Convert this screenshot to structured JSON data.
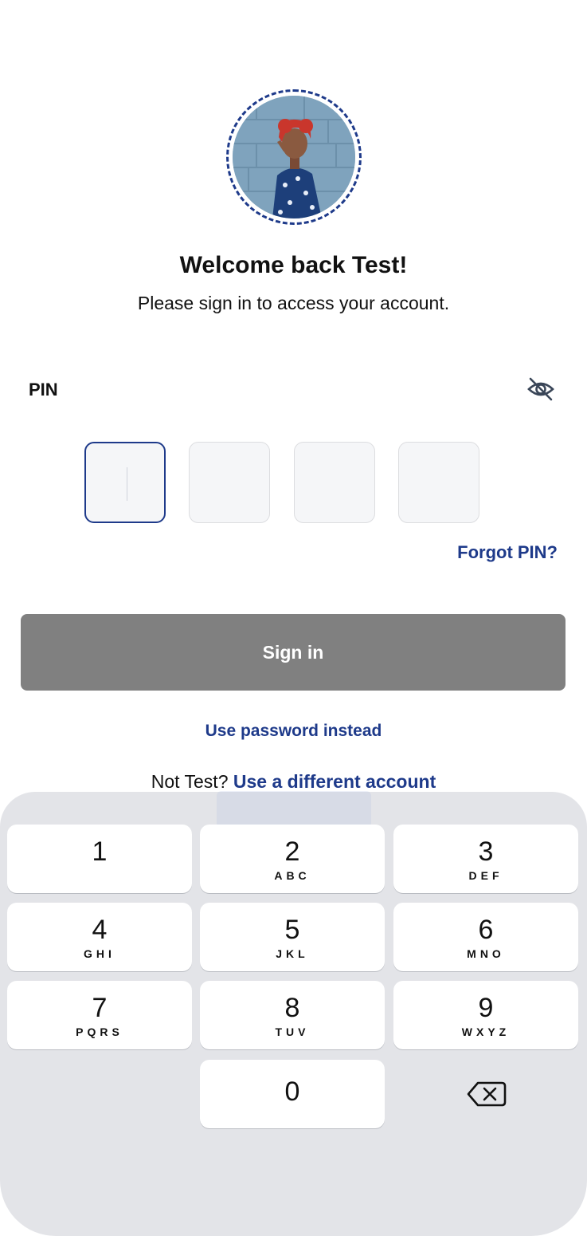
{
  "header": {
    "title": "Welcome back Test!",
    "subtitle": "Please sign in to access your account."
  },
  "pin": {
    "label": "PIN",
    "toggle_icon": "eye-off-icon",
    "boxes": [
      "",
      "",
      "",
      ""
    ],
    "forgot_label": "Forgot PIN?"
  },
  "actions": {
    "signin_label": "Sign in",
    "use_password_label": "Use password instead",
    "not_user_prefix": "Not Test?",
    "different_account_label": "Use a different account"
  },
  "keypad": {
    "keys": [
      {
        "digit": "1",
        "letters": ""
      },
      {
        "digit": "2",
        "letters": "ABC"
      },
      {
        "digit": "3",
        "letters": "DEF"
      },
      {
        "digit": "4",
        "letters": "GHI"
      },
      {
        "digit": "5",
        "letters": "JKL"
      },
      {
        "digit": "6",
        "letters": "MNO"
      },
      {
        "digit": "7",
        "letters": "PQRS"
      },
      {
        "digit": "8",
        "letters": "TUV"
      },
      {
        "digit": "9",
        "letters": "WXYZ"
      },
      {
        "digit": "0",
        "letters": ""
      }
    ],
    "backspace_icon": "backspace-icon"
  },
  "colors": {
    "brand": "#1e3a8a",
    "button_disabled": "#808080",
    "keyboard_bg": "#e3e4e8"
  }
}
